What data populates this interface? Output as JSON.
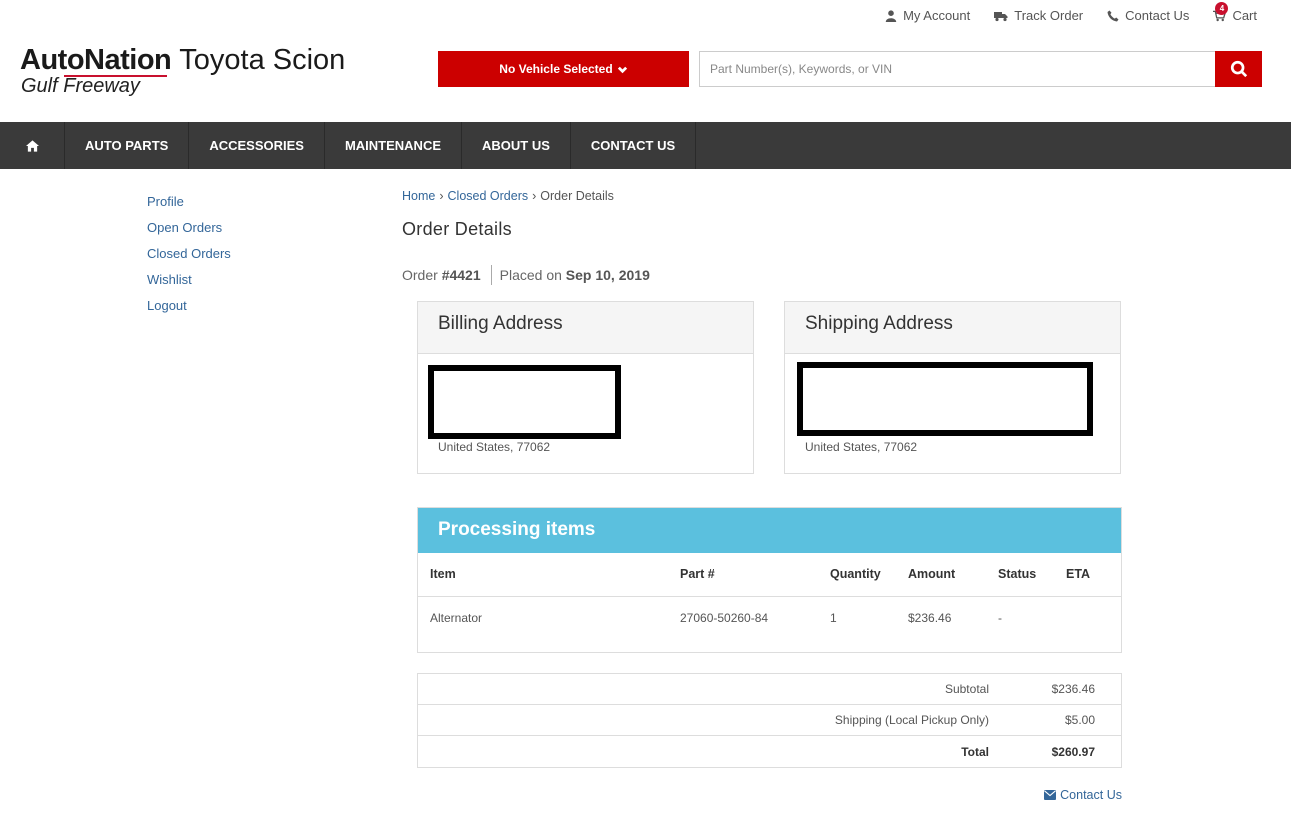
{
  "utility": {
    "account": "My Account",
    "track": "Track Order",
    "contact": "Contact Us",
    "cart": "Cart",
    "cart_count": "4"
  },
  "logo": {
    "name": "AutoNation",
    "brand": "Toyota Scion",
    "location": "Gulf Freeway"
  },
  "vehicle": {
    "label": "No Vehicle Selected"
  },
  "search": {
    "placeholder": "Part Number(s), Keywords, or VIN"
  },
  "nav": {
    "home_icon": "home-icon",
    "items": [
      {
        "label": "AUTO PARTS"
      },
      {
        "label": "ACCESSORIES"
      },
      {
        "label": "MAINTENANCE"
      },
      {
        "label": "ABOUT US"
      },
      {
        "label": "CONTACT US"
      }
    ]
  },
  "sidebar": {
    "items": [
      {
        "label": "Profile"
      },
      {
        "label": "Open Orders"
      },
      {
        "label": "Closed Orders"
      },
      {
        "label": "Wishlist"
      },
      {
        "label": "Logout"
      }
    ]
  },
  "breadcrumb": {
    "home": "Home",
    "closed": "Closed Orders",
    "current": "Order Details",
    "separator": "›"
  },
  "page": {
    "title": "Order Details"
  },
  "order": {
    "prefix": "Order",
    "number": "#4421",
    "placed_prefix": "Placed on",
    "date": "Sep 10, 2019"
  },
  "billing": {
    "title": "Billing Address",
    "country_zip": "United States, 77062"
  },
  "shipping": {
    "title": "Shipping Address",
    "country_zip": "United States, 77062"
  },
  "processing": {
    "title": "Processing items",
    "columns": {
      "item": "Item",
      "part": "Part #",
      "quantity": "Quantity",
      "amount": "Amount",
      "status": "Status",
      "eta": "ETA"
    },
    "rows": [
      {
        "item": "Alternator",
        "part": "27060-50260-84",
        "quantity": "1",
        "amount": "$236.46",
        "status": "-",
        "eta": ""
      }
    ]
  },
  "totals": {
    "subtotal_label": "Subtotal",
    "subtotal": "$236.46",
    "shipping_label": "Shipping (Local Pickup Only)",
    "shipping": "$5.00",
    "total_label": "Total",
    "total": "$260.97"
  },
  "footer": {
    "contact": "Contact Us"
  },
  "colors": {
    "brand_red": "#cc0000",
    "nav_bg": "#3a3a3a",
    "panel_header": "#5bc0de",
    "link": "#336699"
  }
}
